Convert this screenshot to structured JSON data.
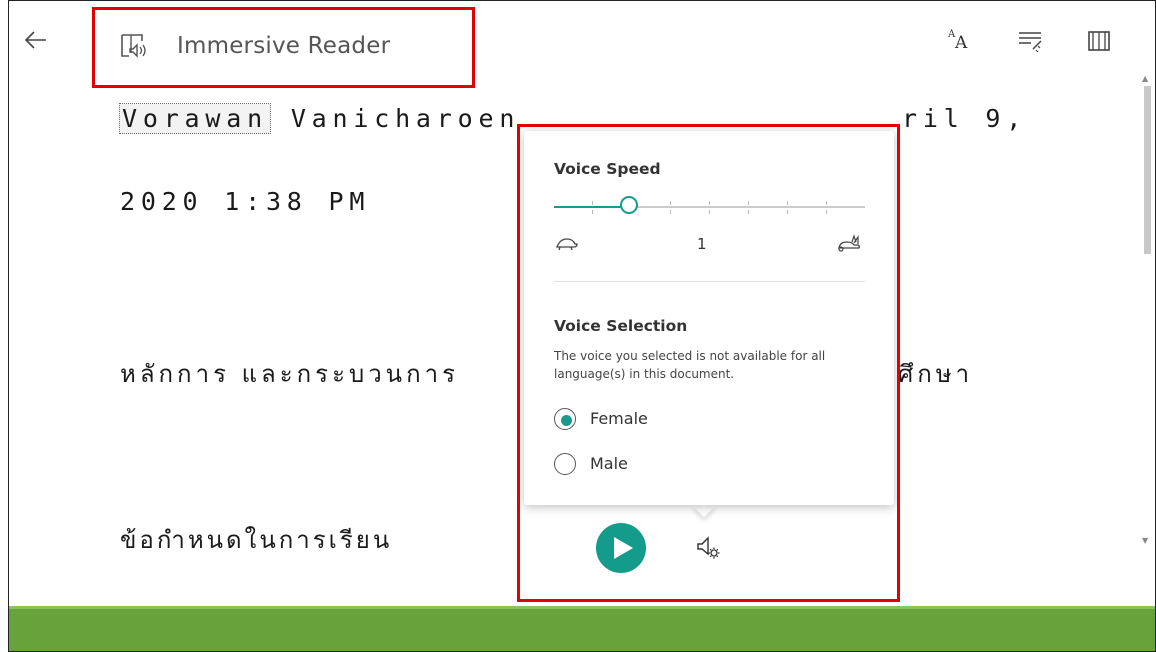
{
  "app": {
    "title": "Immersive Reader"
  },
  "document": {
    "line1_highlighted_word": "Vorawan",
    "line1_rest": " Vanicharoen",
    "line1_tail": "ril 9,",
    "line2": "2020 1:38 PM",
    "line3": "หลักการ และกระบวนการ",
    "line3_tail": "ศึกษา",
    "line4": "ข้อกำหนดในการเรียน"
  },
  "voice_popup": {
    "speed_title": "Voice Speed",
    "speed_value": "1",
    "speed_slider_fraction": 0.25,
    "selection_title": "Voice Selection",
    "selection_note": "The voice you selected is not available for all language(s) in this document.",
    "options": [
      {
        "label": "Female",
        "selected": true
      },
      {
        "label": "Male",
        "selected": false
      }
    ]
  },
  "colors": {
    "accent": "#139b8b",
    "annotation_box": "#e30000",
    "footer": "#67a33a"
  },
  "icons": {
    "back": "back-arrow-icon",
    "logo": "immersive-reader-icon",
    "text_preferences": "text-preferences-icon",
    "grammar_options": "grammar-options-icon",
    "reading_preferences": "reading-preferences-icon",
    "slow": "turtle-icon",
    "fast": "rabbit-icon",
    "play": "play-icon",
    "voice_settings": "voice-settings-icon"
  }
}
